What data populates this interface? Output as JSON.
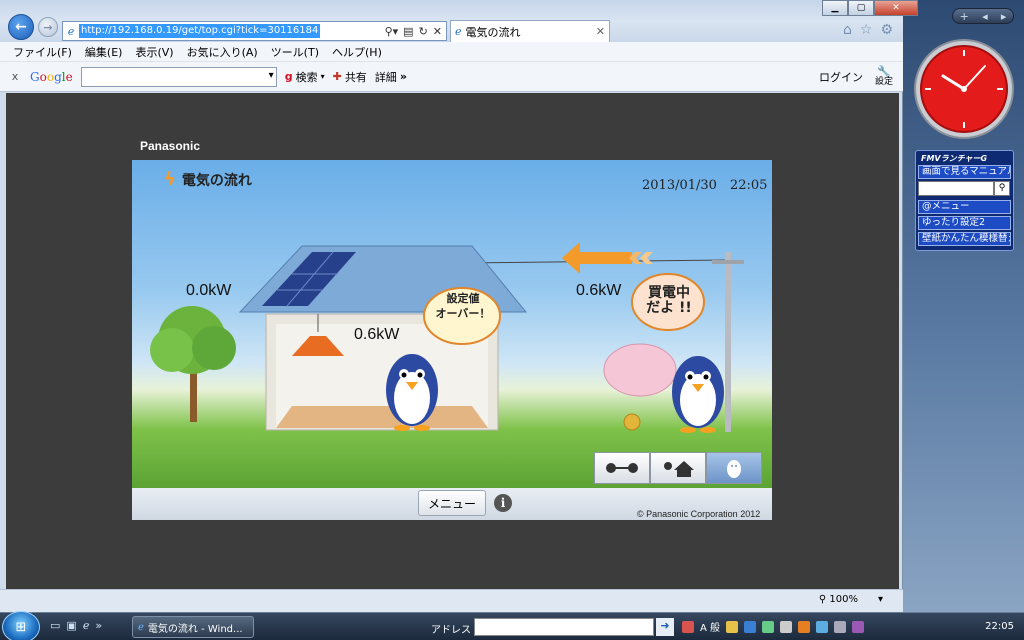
{
  "browser": {
    "url": "http://192.168.0.19/get/top.cgi?tick=30116184",
    "tab_title": "電気の流れ",
    "menu": [
      "ファイル(F)",
      "編集(E)",
      "表示(V)",
      "お気に入り(A)",
      "ツール(T)",
      "ヘルプ(H)"
    ],
    "toolbar": {
      "close": "x",
      "search_label": "検索",
      "share_label": "共有",
      "details_label": "詳細",
      "more": "»",
      "login_label": "ログイン",
      "settings_label": "設定"
    },
    "zoom": "100%"
  },
  "app": {
    "brand": "Panasonic",
    "title": "電気の流れ",
    "datetime": "2013/01/30　22:05",
    "solar_kw": "0.0kW",
    "house_kw": "0.6kW",
    "grid_kw": "0.6kW",
    "bubble_over": "設定値\nオーバー！",
    "bubble_buy": "買電中\nだよ !!",
    "menu_button": "メニュー",
    "info_button": "i",
    "copyright": "© Panasonic Corporation 2012",
    "colors": {
      "accent_orange": "#f39a2a",
      "sky": "#6aaee8",
      "grass": "#5ca335"
    }
  },
  "desktop": {
    "launcher_title": "FMVランチャーG",
    "launcher_items": [
      "画面で見るマニュアル",
      "@メニュー",
      "ゆったり設定2",
      "壁紙かんたん模様替え"
    ]
  },
  "taskbar": {
    "task_label": "電気の流れ - Wind...",
    "address_label": "アドレス",
    "ime": "A 般",
    "time": "22:05"
  }
}
